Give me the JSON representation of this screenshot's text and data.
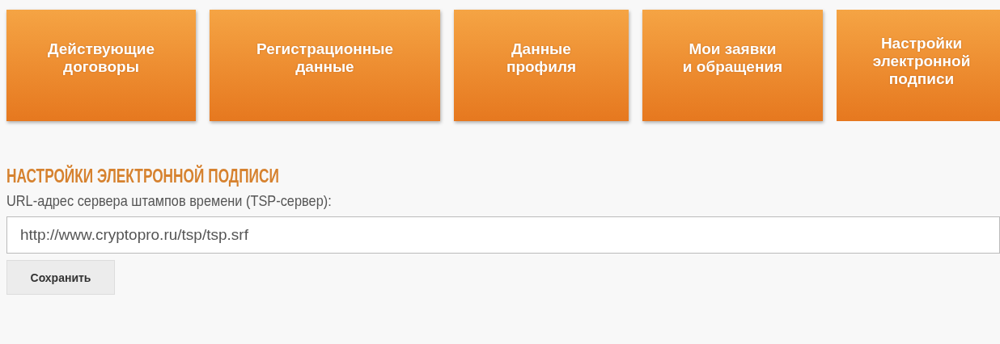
{
  "tabs": [
    {
      "label": "Действующие\nдоговоры",
      "selected": false
    },
    {
      "label": "Регистрационные\nданные",
      "selected": false
    },
    {
      "label": "Данные\nпрофиля",
      "selected": false
    },
    {
      "label": "Мои заявки\nи обращения",
      "selected": false
    },
    {
      "label": "Настройки\nэлектронной\nподписи",
      "selected": true
    }
  ],
  "section": {
    "title": "НАСТРОЙКИ ЭЛЕКТРОННОЙ ПОДПИСИ",
    "field_label": "URL-адрес сервера штампов времени (TSP-сервер):",
    "field_value": "http://www.cryptopro.ru/tsp/tsp.srf",
    "button": "Сохранить"
  }
}
